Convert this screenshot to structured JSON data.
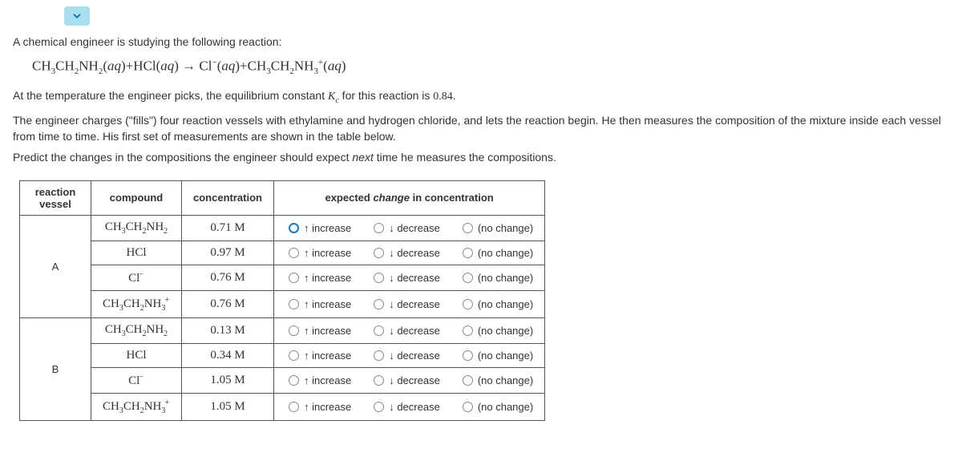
{
  "intro1": "A chemical engineer is studying the following reaction:",
  "equation_html": "CH<span class='sub'>3</span>CH<span class='sub'>2</span>NH<span class='sub'>2</span>(<i>aq</i>)+HCl(<i>aq</i>) &rarr; Cl<span class='sup'>&minus;</span>(<i>aq</i>)+CH<span class='sub'>3</span>CH<span class='sub'>2</span>NH<span class='sub'>3</span><span class='sup'>+</span>(<i>aq</i>)",
  "intro2_pre": "At the temperature the engineer picks, the equilibrium constant ",
  "intro2_post": " for this reaction is ",
  "kc_value": "0.84",
  "para2": "The engineer charges (\"fills\") four reaction vessels with ethylamine and hydrogen chloride, and lets the reaction begin. He then measures the composition of the mixture inside each vessel from time to time. His first set of measurements are shown in the table below.",
  "para3_pre": "Predict the changes in the compositions the engineer should expect ",
  "para3_next": "next",
  "para3_post": " time he measures the compositions.",
  "headers": {
    "vessel": "reaction vessel",
    "compound": "compound",
    "conc": "concentration",
    "change_pre": "expected ",
    "change_em": "change",
    "change_post": " in concentration"
  },
  "options": {
    "increase": "↑ increase",
    "decrease": "↓ decrease",
    "nochange": "(no change)"
  },
  "vessels": [
    {
      "label": "A",
      "rows": [
        {
          "compound_html": "CH<span class='sub'>3</span>CH<span class='sub'>2</span>NH<span class='sub'>2</span>",
          "conc": "0.71 M",
          "selected": "increase"
        },
        {
          "compound_html": "HCl",
          "conc": "0.97 M",
          "selected": ""
        },
        {
          "compound_html": "Cl<span class='sup'>&minus;</span>",
          "conc": "0.76 M",
          "selected": ""
        },
        {
          "compound_html": "CH<span class='sub'>3</span>CH<span class='sub'>2</span>NH<span class='sub'>3</span><span class='sup'>+</span>",
          "conc": "0.76 M",
          "selected": ""
        }
      ]
    },
    {
      "label": "B",
      "rows": [
        {
          "compound_html": "CH<span class='sub'>3</span>CH<span class='sub'>2</span>NH<span class='sub'>2</span>",
          "conc": "0.13 M",
          "selected": ""
        },
        {
          "compound_html": "HCl",
          "conc": "0.34 M",
          "selected": ""
        },
        {
          "compound_html": "Cl<span class='sup'>&minus;</span>",
          "conc": "1.05 M",
          "selected": ""
        },
        {
          "compound_html": "CH<span class='sub'>3</span>CH<span class='sub'>2</span>NH<span class='sub'>3</span><span class='sup'>+</span>",
          "conc": "1.05 M",
          "selected": ""
        }
      ]
    }
  ]
}
